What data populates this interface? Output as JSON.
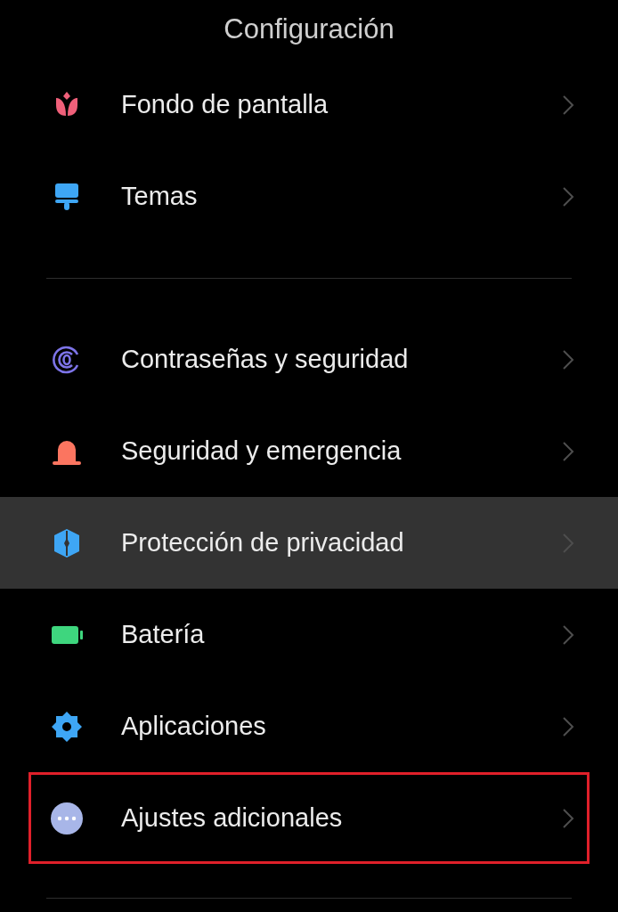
{
  "title": "Configuración",
  "groups": [
    [
      {
        "label": "Fondo de pantalla",
        "kind": "tulip",
        "selected": false,
        "framed": false
      },
      {
        "label": "Temas",
        "kind": "brush",
        "selected": false,
        "framed": false
      }
    ],
    [
      {
        "label": "Contraseñas y seguridad",
        "kind": "fingerprint",
        "selected": false,
        "framed": false
      },
      {
        "label": "Seguridad y emergencia",
        "kind": "siren",
        "selected": false,
        "framed": false
      },
      {
        "label": "Protección de privacidad",
        "kind": "shield",
        "selected": true,
        "framed": false
      },
      {
        "label": "Batería",
        "kind": "battery",
        "selected": false,
        "framed": false
      },
      {
        "label": "Aplicaciones",
        "kind": "gear",
        "selected": false,
        "framed": false
      },
      {
        "label": "Ajustes adicionales",
        "kind": "more",
        "selected": false,
        "framed": true
      }
    ]
  ]
}
